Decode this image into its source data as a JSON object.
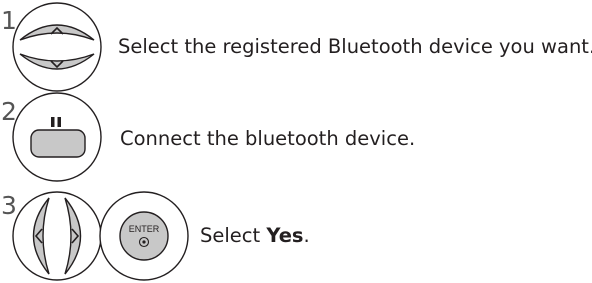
{
  "steps": [
    {
      "number": "1",
      "text": "Select the registered Bluetooth device you want.",
      "remote_keys": [
        "up-arrow-icon",
        "down-arrow-icon"
      ]
    },
    {
      "number": "2",
      "text": "Connect the bluetooth device.",
      "remote_keys": [
        "pause-icon"
      ]
    },
    {
      "number": "3",
      "text_prefix": "Select ",
      "text_bold": "Yes",
      "text_suffix": ".",
      "remote_keys": [
        "left-arrow-icon",
        "right-arrow-icon",
        "enter-button-icon"
      ],
      "enter_label": "ENTER"
    }
  ],
  "colors": {
    "key_fill": "#c8c8c8",
    "key_outline": "#231f20",
    "text": "#231f20"
  }
}
